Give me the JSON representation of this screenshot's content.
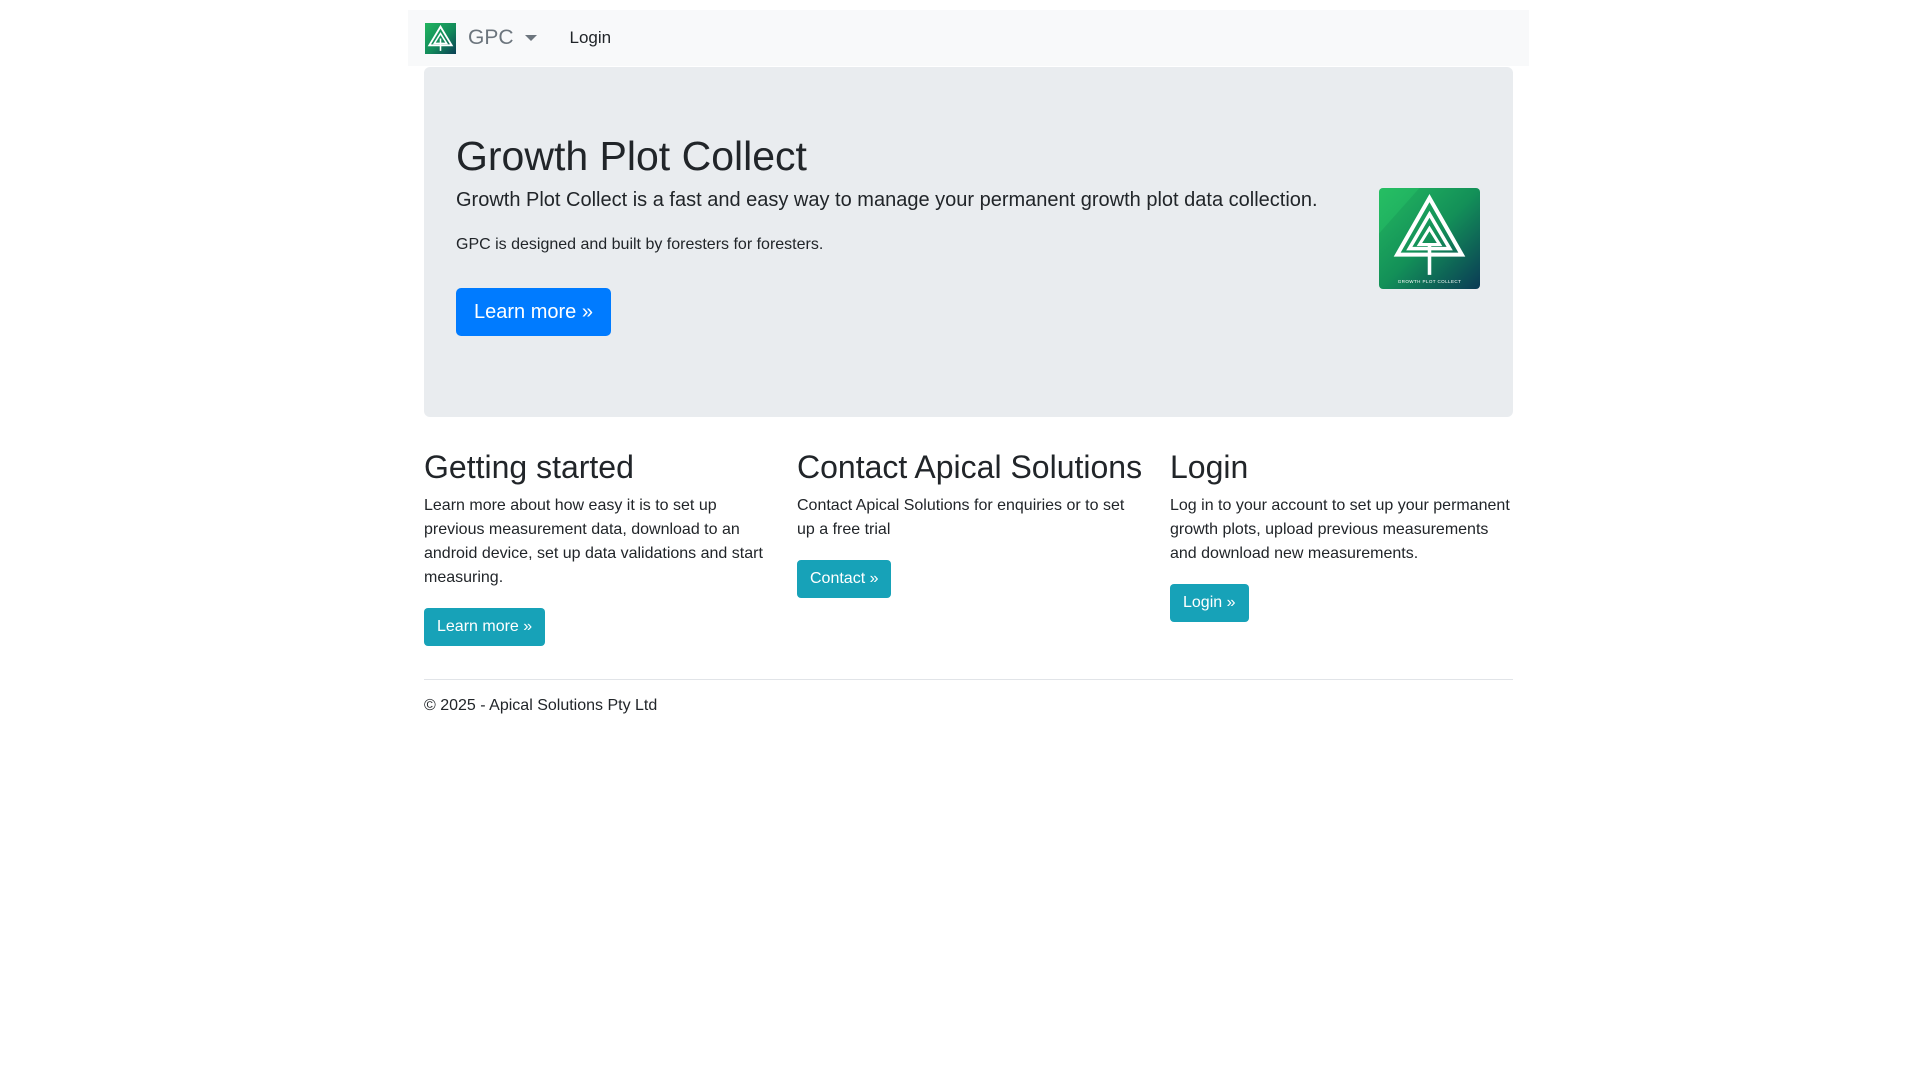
{
  "navbar": {
    "brand": "GPC",
    "login_label": "Login",
    "logo_icon": "growth-plot-collect-logo-icon"
  },
  "jumbotron": {
    "title": "Growth Plot Collect",
    "lead": "Growth Plot Collect is a fast and easy way to manage your permanent growth plot data collection.",
    "subtitle": "GPC is designed and built by foresters for foresters.",
    "button_label": "Learn more »",
    "logo_caption": "GROWTH PLOT COLLECT"
  },
  "columns": [
    {
      "heading": "Getting started",
      "text": "Learn more about how easy it is to set up previous measurement data, download to an android device, set up data validations and start measuring.",
      "button_label": "Learn more »"
    },
    {
      "heading": "Contact Apical Solutions",
      "text": "Contact Apical Solutions for enquiries or to set up a free trial",
      "button_label": "Contact »"
    },
    {
      "heading": "Login",
      "text": "Log in to your account to set up your permanent growth plots, upload previous measurements and download new measurements.",
      "button_label": "Login »"
    }
  ],
  "footer": {
    "copyright": "© 2025 - Apical Solutions Pty Ltd"
  },
  "colors": {
    "primary": "#007bff",
    "info": "#17a2b8",
    "navbar_bg": "#f8f9fa",
    "jumbotron_bg": "#e9ecef",
    "logo_green": "#1aa25a",
    "logo_dark": "#0b4a5a"
  }
}
